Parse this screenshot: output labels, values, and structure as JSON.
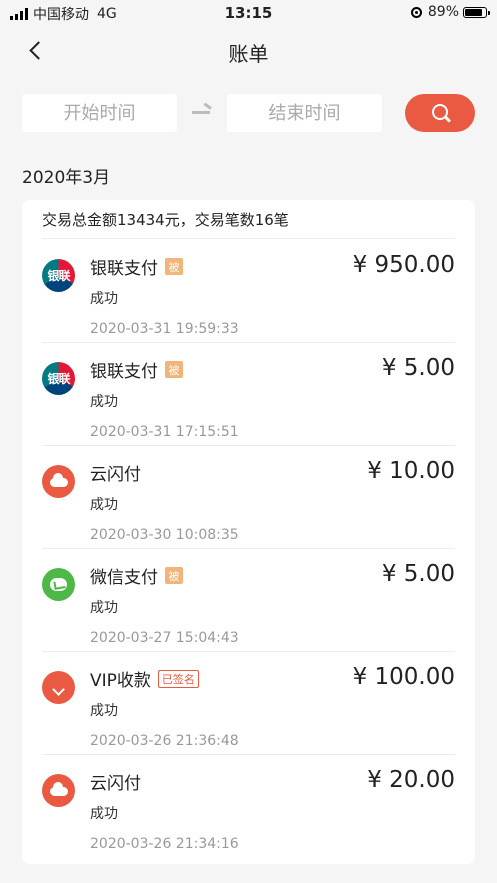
{
  "status_bar": {
    "carrier": "中国移动",
    "network": "4G",
    "time": "13:15",
    "battery": "89%"
  },
  "nav": {
    "title": "账单"
  },
  "filter": {
    "start_placeholder": "开始时间",
    "end_placeholder": "结束时间"
  },
  "month": "2020年3月",
  "summary": "交易总金额13434元，交易笔数16笔",
  "transactions": [
    {
      "icon": "unionpay-icon",
      "icon_text": "银联",
      "name": "银联支付",
      "tag": "被",
      "status": "成功",
      "time": "2020-03-31 19:59:33",
      "amount": "¥ 950.00"
    },
    {
      "icon": "unionpay-icon",
      "icon_text": "银联",
      "name": "银联支付",
      "tag": "被",
      "status": "成功",
      "time": "2020-03-31 17:15:51",
      "amount": "¥ 5.00"
    },
    {
      "icon": "cloud-quickpass-icon",
      "name": "云闪付",
      "status": "成功",
      "time": "2020-03-30 10:08:35",
      "amount": "¥ 10.00"
    },
    {
      "icon": "wechat-pay-icon",
      "name": "微信支付",
      "tag": "被",
      "status": "成功",
      "time": "2020-03-27 15:04:43",
      "amount": "¥ 5.00"
    },
    {
      "icon": "vip-payment-icon",
      "name": "VIP收款",
      "tag_signed": "已签名",
      "status": "成功",
      "time": "2020-03-26 21:36:48",
      "amount": "¥ 100.00"
    },
    {
      "icon": "cloud-quickpass-icon",
      "name": "云闪付",
      "status": "成功",
      "time": "2020-03-26 21:34:16",
      "amount": "¥ 20.00"
    }
  ],
  "colors": {
    "accent": "#ea5a43",
    "tag": "#f3b47a",
    "background": "#f5f5f5"
  }
}
